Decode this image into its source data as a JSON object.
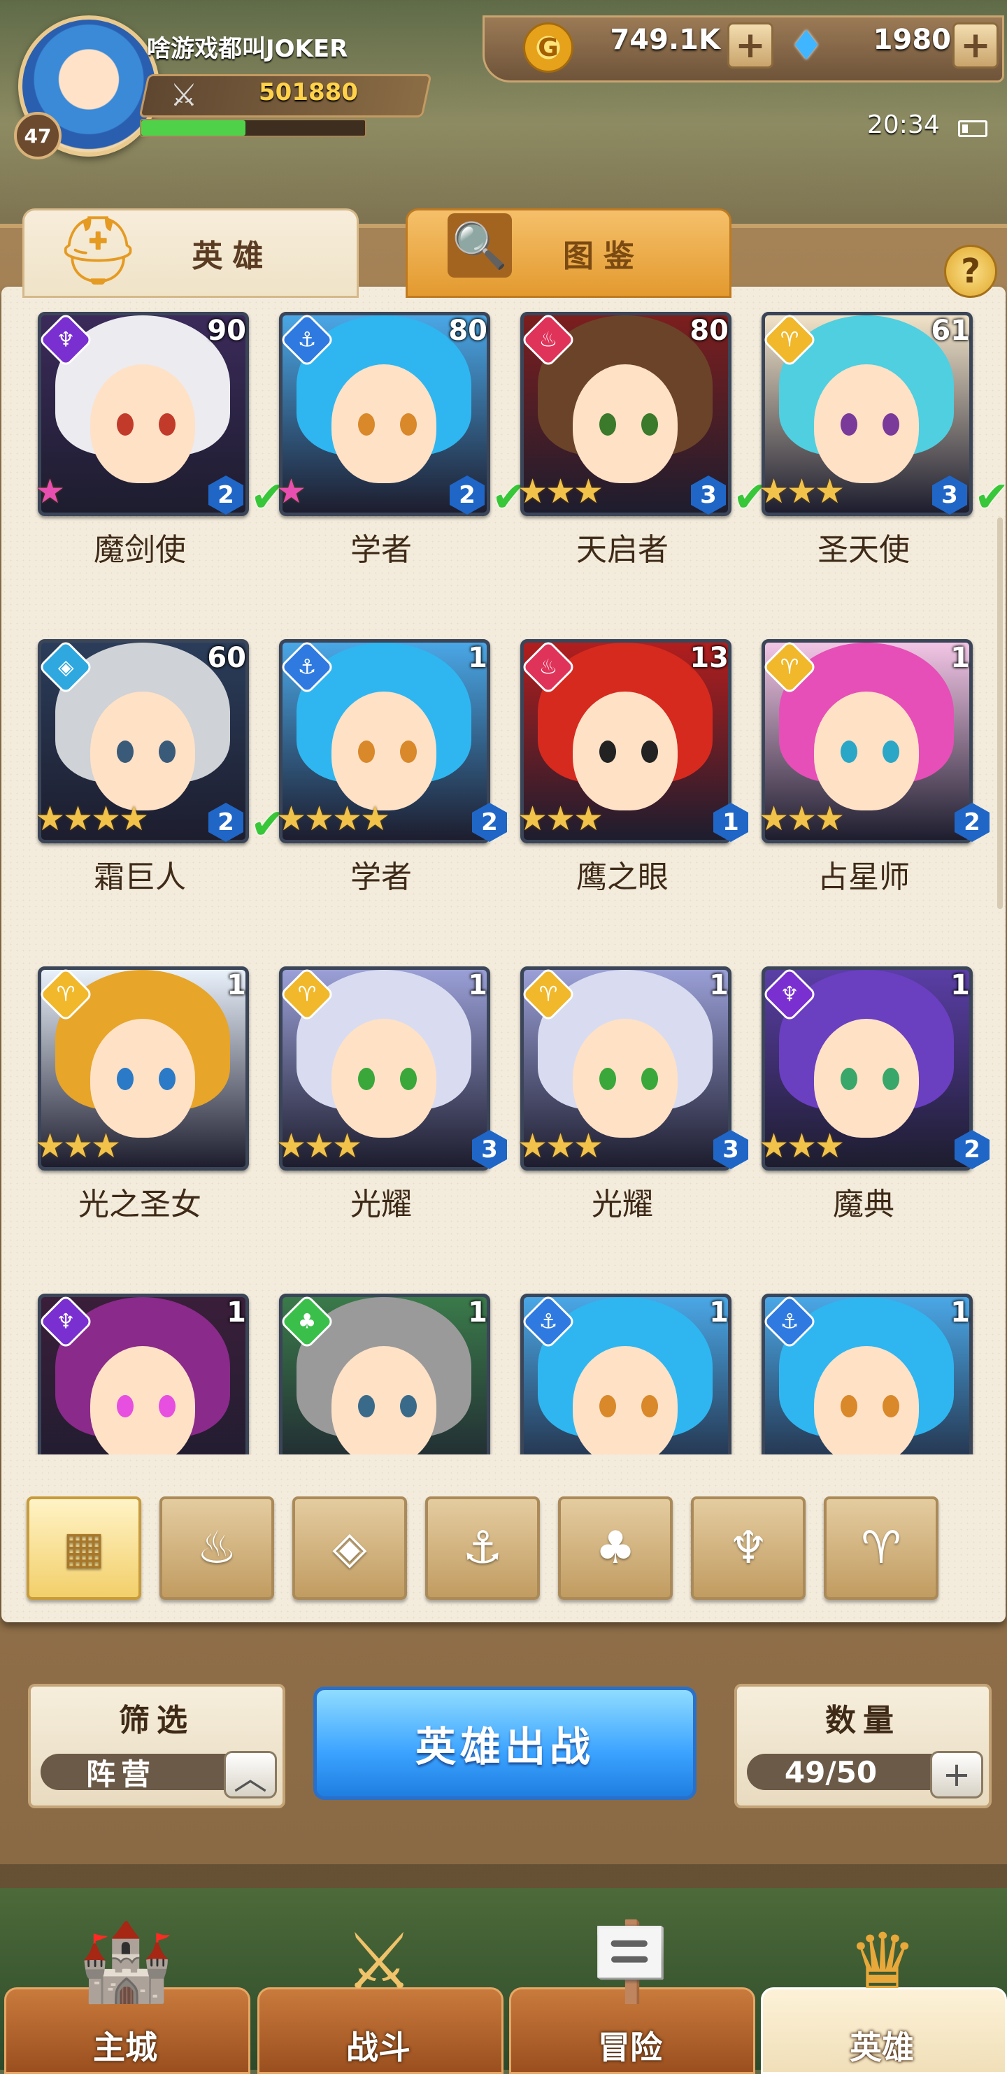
{
  "player": {
    "name": "啥游戏都叫JOKER",
    "level": "47",
    "power": "501880",
    "xp_fraction": 0.47
  },
  "resources": {
    "gold": "749.1K",
    "gems": "1980",
    "gold_symbol": "G"
  },
  "status": {
    "time": "20:34"
  },
  "tabs": [
    {
      "label": "英雄"
    },
    {
      "label": "图鉴"
    }
  ],
  "help_label": "?",
  "heroes": [
    {
      "name": "魔剑使",
      "level": "90",
      "faction": "dark",
      "rank": "2",
      "stars": 0,
      "rainbow": true,
      "check": true,
      "colors": {
        "bg": "#3b2a5a",
        "hair": "#ecebf0",
        "eye": "#c23a2a"
      }
    },
    {
      "name": "学者",
      "level": "80",
      "faction": "water",
      "rank": "2",
      "stars": 0,
      "rainbow": true,
      "check": true,
      "colors": {
        "bg": "#4aa7e6",
        "hair": "#2fb6f0",
        "eye": "#d9882a"
      }
    },
    {
      "name": "天启者",
      "level": "80",
      "faction": "fire",
      "rank": "3",
      "stars": 3,
      "rainbow": false,
      "check": true,
      "colors": {
        "bg": "#7c1e1e",
        "hair": "#6b4329",
        "eye": "#3a7a2a"
      }
    },
    {
      "name": "圣天使",
      "level": "61",
      "faction": "light",
      "rank": "3",
      "stars": 3,
      "rainbow": false,
      "check": true,
      "colors": {
        "bg": "#f1e3c8",
        "hair": "#4fcfe0",
        "eye": "#7a3a9a"
      }
    },
    {
      "name": "霜巨人",
      "level": "60",
      "faction": "ice",
      "rank": "2",
      "stars": 4,
      "rainbow": false,
      "check": true,
      "colors": {
        "bg": "#2a3d5a",
        "hair": "#cfd2d6",
        "eye": "#3a5a7a"
      }
    },
    {
      "name": "学者",
      "level": "1",
      "faction": "water",
      "rank": "2",
      "stars": 4,
      "rainbow": false,
      "check": false,
      "colors": {
        "bg": "#4aa7e6",
        "hair": "#2fb6f0",
        "eye": "#d9882a"
      }
    },
    {
      "name": "鹰之眼",
      "level": "13",
      "faction": "fire",
      "rank": "1",
      "stars": 3,
      "rainbow": false,
      "check": false,
      "colors": {
        "bg": "#b21e1e",
        "hair": "#d62a1f",
        "eye": "#222222"
      }
    },
    {
      "name": "占星师",
      "level": "1",
      "faction": "light",
      "rank": "2",
      "stars": 3,
      "rainbow": false,
      "check": false,
      "colors": {
        "bg": "#f3c6e6",
        "hair": "#e64fb7",
        "eye": "#2aa7c7"
      }
    },
    {
      "name": "光之圣女",
      "level": "1",
      "faction": "light",
      "rank": "",
      "stars": 3,
      "rainbow": false,
      "check": false,
      "colors": {
        "bg": "#e9f1fb",
        "hair": "#e7a52a",
        "eye": "#2a7ac7"
      }
    },
    {
      "name": "光耀",
      "level": "1",
      "faction": "light",
      "rank": "3",
      "stars": 3,
      "rainbow": false,
      "check": false,
      "colors": {
        "bg": "#9a9fd6",
        "hair": "#d9dcf0",
        "eye": "#3aa73a"
      }
    },
    {
      "name": "光耀",
      "level": "1",
      "faction": "light",
      "rank": "3",
      "stars": 3,
      "rainbow": false,
      "check": false,
      "colors": {
        "bg": "#9a9fd6",
        "hair": "#d9dcf0",
        "eye": "#3aa73a"
      }
    },
    {
      "name": "魔典",
      "level": "1",
      "faction": "dark",
      "rank": "2",
      "stars": 3,
      "rainbow": false,
      "check": false,
      "colors": {
        "bg": "#5a3ea6",
        "hair": "#6a3fc0",
        "eye": "#3aa76a"
      }
    },
    {
      "name": "",
      "level": "1",
      "faction": "dark",
      "rank": "",
      "stars": 0,
      "rainbow": false,
      "check": false,
      "colors": {
        "bg": "#3a1e3a",
        "hair": "#8a2a8a",
        "eye": "#e64fe0"
      }
    },
    {
      "name": "",
      "level": "1",
      "faction": "nature",
      "rank": "",
      "stars": 0,
      "rainbow": false,
      "check": false,
      "colors": {
        "bg": "#3a7a4a",
        "hair": "#9a9a9a",
        "eye": "#3a6a8a"
      }
    },
    {
      "name": "",
      "level": "1",
      "faction": "water",
      "rank": "",
      "stars": 0,
      "rainbow": false,
      "check": false,
      "colors": {
        "bg": "#4aa7e6",
        "hair": "#2fb6f0",
        "eye": "#d9882a"
      }
    },
    {
      "name": "",
      "level": "1",
      "faction": "water",
      "rank": "",
      "stars": 0,
      "rainbow": false,
      "check": false,
      "colors": {
        "bg": "#4aa7e6",
        "hair": "#2fb6f0",
        "eye": "#d9882a"
      }
    }
  ],
  "faction_colors": {
    "dark": "#7a2fd0",
    "water": "#2f7ae0",
    "fire": "#e0335a",
    "light": "#f0b82a",
    "ice": "#2fa8e0",
    "nature": "#3ac04a"
  },
  "faction_glyphs": {
    "dark": "♆",
    "water": "⚓",
    "fire": "♨",
    "light": "♈",
    "ice": "◈",
    "nature": "♣"
  },
  "filters": [
    {
      "name": "all-filter",
      "glyph": "▦",
      "active": true
    },
    {
      "name": "fire-filter",
      "glyph": "♨",
      "active": false
    },
    {
      "name": "ice-filter",
      "glyph": "◈",
      "active": false
    },
    {
      "name": "water-filter",
      "glyph": "⚓",
      "active": false
    },
    {
      "name": "nature-filter",
      "glyph": "♣",
      "active": false
    },
    {
      "name": "dark-filter",
      "glyph": "♆",
      "active": false
    },
    {
      "name": "light-filter",
      "glyph": "♈",
      "active": false
    }
  ],
  "controls": {
    "filter_title": "筛选",
    "filter_value": "阵营",
    "deploy_label": "英雄出战",
    "count_title": "数量",
    "count_value": "49/50"
  },
  "nav": [
    {
      "label": "主城",
      "icon": "castle-icon",
      "glyph": "🏰",
      "active": false
    },
    {
      "label": "战斗",
      "icon": "swords-icon",
      "glyph": "⚔",
      "active": false
    },
    {
      "label": "冒险",
      "icon": "signpost-icon",
      "glyph": "🪧",
      "active": false
    },
    {
      "label": "英雄",
      "icon": "crest-icon",
      "glyph": "♛",
      "active": true
    }
  ]
}
